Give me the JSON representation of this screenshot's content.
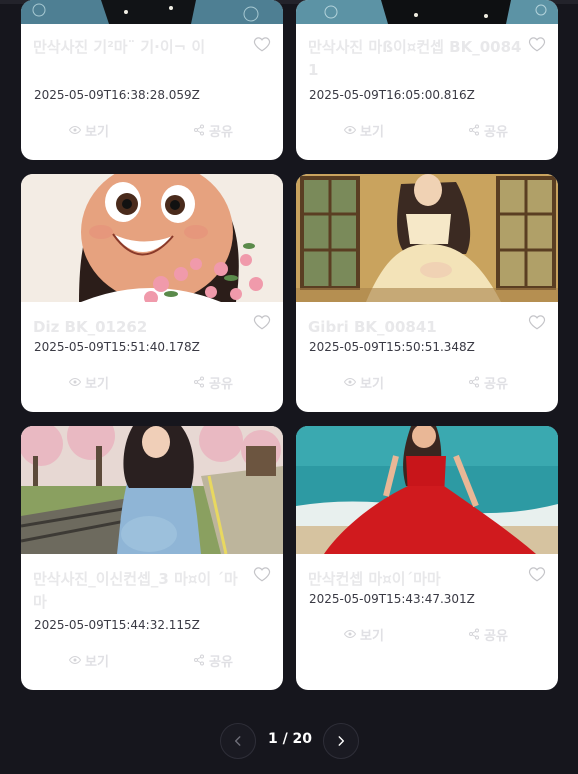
{
  "cards": [
    {
      "title": "만삭사진 기²마¨ 기·이¬ 이",
      "date": "2025-05-09T16:38:28.059Z",
      "view_label": "보기",
      "share_label": "공유"
    },
    {
      "title": "만삭사진 마ß이¤컨셉 BK_00841",
      "date": "2025-05-09T16:05:00.816Z",
      "view_label": "보기",
      "share_label": "공유"
    },
    {
      "title": "Diz BK_01262",
      "date": "2025-05-09T15:51:40.178Z",
      "view_label": "보기",
      "share_label": "공유"
    },
    {
      "title": "Gibri BK_00841",
      "date": "2025-05-09T15:50:51.348Z",
      "view_label": "보기",
      "share_label": "공유"
    },
    {
      "title": "만삭사진_이신컨셉_3 마¤이 ´마마",
      "date": "2025-05-09T15:44:32.115Z",
      "view_label": "보기",
      "share_label": "공유"
    },
    {
      "title": "만삭컨셉 마¤이´마마",
      "date": "2025-05-09T15:43:47.301Z",
      "view_label": "보기",
      "share_label": "공유"
    }
  ],
  "pagination": {
    "text": "1 / 20"
  },
  "colors": {
    "background": "#16161d",
    "card": "#ffffff",
    "faded_text": "#e8e8ea"
  }
}
